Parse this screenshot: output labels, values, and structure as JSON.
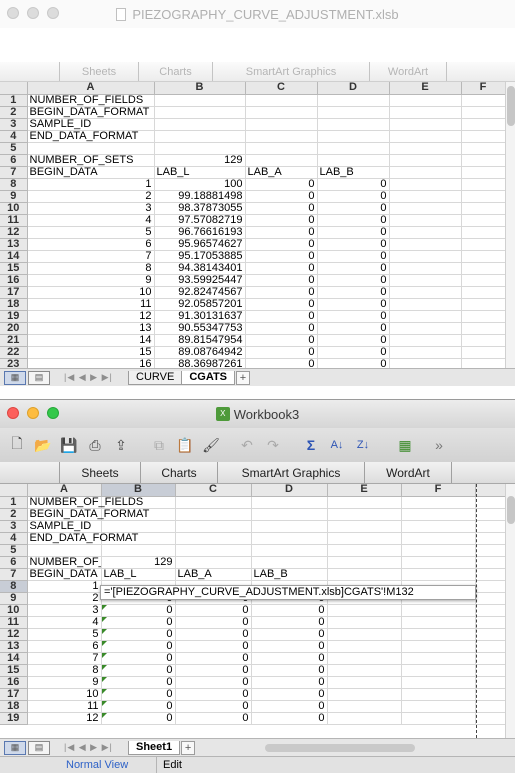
{
  "back_window": {
    "title": "PIEZOGRAPHY_CURVE_ADJUSTMENT.xlsb",
    "ribbon_tabs": [
      "Sheets",
      "Charts",
      "SmartArt Graphics",
      "WordArt"
    ],
    "columns": [
      "A",
      "B",
      "C",
      "D",
      "E",
      "F"
    ],
    "rows": [
      {
        "n": "1",
        "a": "NUMBER_OF_FIELDS",
        "b": "",
        "c": "",
        "d": ""
      },
      {
        "n": "2",
        "a": "BEGIN_DATA_FORMAT",
        "b": "",
        "c": "",
        "d": ""
      },
      {
        "n": "3",
        "a": "SAMPLE_ID",
        "b": "",
        "c": "",
        "d": ""
      },
      {
        "n": "4",
        "a": "END_DATA_FORMAT",
        "b": "",
        "c": "",
        "d": ""
      },
      {
        "n": "5",
        "a": "",
        "b": "",
        "c": "",
        "d": ""
      },
      {
        "n": "6",
        "a": "NUMBER_OF_SETS",
        "b": "129",
        "c": "",
        "d": ""
      },
      {
        "n": "7",
        "a": "BEGIN_DATA",
        "b": "LAB_L",
        "c": "LAB_A",
        "d": "LAB_B"
      },
      {
        "n": "8",
        "a": "1",
        "b": "100",
        "c": "0",
        "d": "0"
      },
      {
        "n": "9",
        "a": "2",
        "b": "99.18881498",
        "c": "0",
        "d": "0"
      },
      {
        "n": "10",
        "a": "3",
        "b": "98.37873055",
        "c": "0",
        "d": "0"
      },
      {
        "n": "11",
        "a": "4",
        "b": "97.57082719",
        "c": "0",
        "d": "0"
      },
      {
        "n": "12",
        "a": "5",
        "b": "96.76616193",
        "c": "0",
        "d": "0"
      },
      {
        "n": "13",
        "a": "6",
        "b": "95.96574627",
        "c": "0",
        "d": "0"
      },
      {
        "n": "14",
        "a": "7",
        "b": "95.17053885",
        "c": "0",
        "d": "0"
      },
      {
        "n": "15",
        "a": "8",
        "b": "94.38143401",
        "c": "0",
        "d": "0"
      },
      {
        "n": "16",
        "a": "9",
        "b": "93.59925447",
        "c": "0",
        "d": "0"
      },
      {
        "n": "17",
        "a": "10",
        "b": "92.82474567",
        "c": "0",
        "d": "0"
      },
      {
        "n": "18",
        "a": "11",
        "b": "92.05857201",
        "c": "0",
        "d": "0"
      },
      {
        "n": "19",
        "a": "12",
        "b": "91.30131637",
        "c": "0",
        "d": "0"
      },
      {
        "n": "20",
        "a": "13",
        "b": "90.55347753",
        "c": "0",
        "d": "0"
      },
      {
        "n": "21",
        "a": "14",
        "b": "89.81547954",
        "c": "0",
        "d": "0"
      },
      {
        "n": "22",
        "a": "15",
        "b": "89.08764942",
        "c": "0",
        "d": "0"
      },
      {
        "n": "23",
        "a": "16",
        "b": "88.36987261",
        "c": "0",
        "d": "0"
      }
    ],
    "sheet_tabs": [
      "CURVE",
      "CGATS"
    ],
    "active_sheet": "CGATS",
    "add_tab": "+"
  },
  "front_window": {
    "title": "Workbook3",
    "ribbon_tabs": [
      "Sheets",
      "Charts",
      "SmartArt Graphics",
      "WordArt"
    ],
    "columns": [
      "A",
      "B",
      "C",
      "D",
      "E",
      "F"
    ],
    "rows": [
      {
        "n": "1",
        "a": "NUMBER_OF_FIELDS",
        "b": "",
        "c": "",
        "d": ""
      },
      {
        "n": "2",
        "a": "BEGIN_DATA_FORMAT",
        "b": "",
        "c": "",
        "d": ""
      },
      {
        "n": "3",
        "a": "SAMPLE_ID",
        "b": "",
        "c": "",
        "d": ""
      },
      {
        "n": "4",
        "a": "END_DATA_FORMAT",
        "b": "",
        "c": "",
        "d": ""
      },
      {
        "n": "5",
        "a": "",
        "b": "",
        "c": "",
        "d": ""
      },
      {
        "n": "6",
        "a": "NUMBER_OF_S",
        "b": "129",
        "c": "",
        "d": ""
      },
      {
        "n": "7",
        "a": "BEGIN_DATA",
        "b": "LAB_L",
        "c": "LAB_A",
        "d": "LAB_B"
      },
      {
        "n": "8",
        "a": "1",
        "b": "",
        "c": "",
        "d": ""
      },
      {
        "n": "9",
        "a": "2",
        "b": "0",
        "c": "0",
        "d": "0"
      },
      {
        "n": "10",
        "a": "3",
        "b": "0",
        "c": "0",
        "d": "0"
      },
      {
        "n": "11",
        "a": "4",
        "b": "0",
        "c": "0",
        "d": "0"
      },
      {
        "n": "12",
        "a": "5",
        "b": "0",
        "c": "0",
        "d": "0"
      },
      {
        "n": "13",
        "a": "6",
        "b": "0",
        "c": "0",
        "d": "0"
      },
      {
        "n": "14",
        "a": "7",
        "b": "0",
        "c": "0",
        "d": "0"
      },
      {
        "n": "15",
        "a": "8",
        "b": "0",
        "c": "0",
        "d": "0"
      },
      {
        "n": "16",
        "a": "9",
        "b": "0",
        "c": "0",
        "d": "0"
      },
      {
        "n": "17",
        "a": "10",
        "b": "0",
        "c": "0",
        "d": "0"
      },
      {
        "n": "18",
        "a": "11",
        "b": "0",
        "c": "0",
        "d": "0"
      },
      {
        "n": "19",
        "a": "12",
        "b": "0",
        "c": "0",
        "d": "0"
      }
    ],
    "edit_formula": "='[PIEZOGRAPHY_CURVE_ADJUSTMENT.xlsb]CGATS'!M132",
    "sheet_tabs": [
      "Sheet1"
    ],
    "active_sheet": "Sheet1",
    "add_tab": "+",
    "status": {
      "view": "Normal View",
      "mode": "Edit"
    },
    "toolbar_icons": [
      "new-icon",
      "open-icon",
      "save-icon",
      "print-icon",
      "import-icon",
      "copy-icon",
      "paste-icon",
      "format-painter-icon",
      "undo-icon",
      "redo-icon",
      "autosum-icon",
      "sort-ascending-icon",
      "sort-descending-icon",
      "gallery-icon",
      "more-icon"
    ]
  }
}
